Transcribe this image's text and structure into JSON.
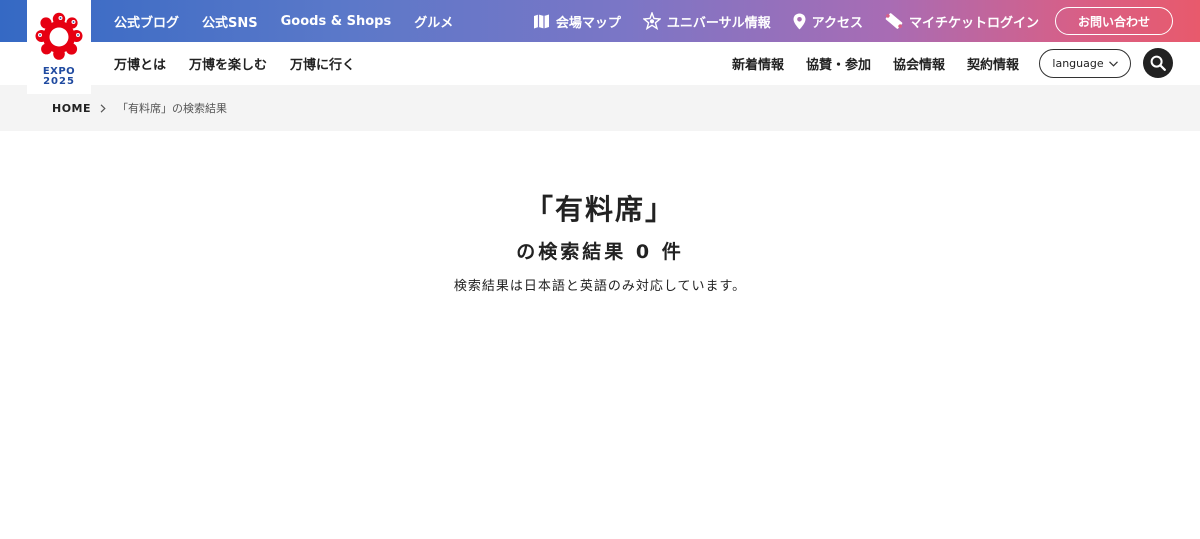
{
  "logo": {
    "line1": "EXPO",
    "line2": "2025"
  },
  "top_nav": {
    "left_links": [
      "公式ブログ",
      "公式SNS",
      "Goods & Shops",
      "グルメ"
    ],
    "right_links": [
      {
        "label": "会場マップ",
        "icon": "map-icon"
      },
      {
        "label": "ユニバーサル情報",
        "icon": "universal-icon"
      },
      {
        "label": "アクセス",
        "icon": "location-pin-icon"
      },
      {
        "label": "マイチケットログイン",
        "icon": "ticket-icon"
      }
    ],
    "contact_label": "お問い合わせ"
  },
  "main_nav": {
    "left_links": [
      "万博とは",
      "万博を楽しむ",
      "万博に行く"
    ],
    "right_links": [
      "新着情報",
      "協賛・参加",
      "協会情報",
      "契約情報"
    ],
    "language_label": "language"
  },
  "breadcrumb": {
    "home": "HOME",
    "current": "「有料席」の検索結果"
  },
  "results": {
    "query_display": "「有料席」",
    "count_text": "の検索結果 0 件",
    "note": "検索結果は日本語と英語のみ対応しています。"
  },
  "colors": {
    "gradient_start": "#3569c4",
    "gradient_end": "#e85a6c",
    "logo_red": "#e60012",
    "logo_blue": "#1f4aa0"
  }
}
